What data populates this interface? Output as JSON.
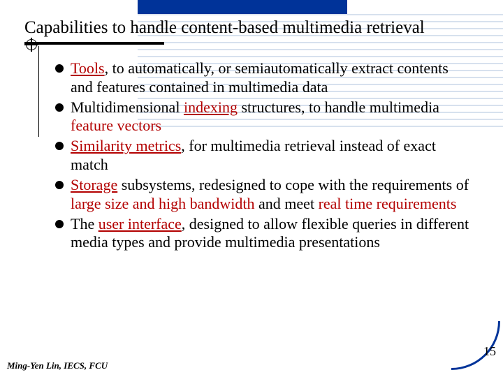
{
  "title": "Capabilities to handle content-based multimedia retrieval",
  "bullets": [
    {
      "segments": [
        {
          "text": "Tools",
          "u": true,
          "r": true
        },
        {
          "text": ", to automatically, or semiautomatically extract contents and features contained in multimedia data"
        }
      ]
    },
    {
      "segments": [
        {
          "text": "Multidimensional "
        },
        {
          "text": "indexing",
          "u": true,
          "r": true
        },
        {
          "text": " structures, to handle multimedia "
        },
        {
          "text": "feature vectors",
          "r": true
        }
      ]
    },
    {
      "segments": [
        {
          "text": "Similarity metrics",
          "u": true,
          "r": true
        },
        {
          "text": ", for multimedia retrieval instead of exact match"
        }
      ]
    },
    {
      "segments": [
        {
          "text": "Storage",
          "u": true,
          "r": true
        },
        {
          "text": " subsystems, redesigned to cope with the requirements of "
        },
        {
          "text": "large size and high bandwidth",
          "r": true
        },
        {
          "text": " and meet "
        },
        {
          "text": "real time requirements",
          "r": true
        }
      ]
    },
    {
      "segments": [
        {
          "text": "The "
        },
        {
          "text": "user interface",
          "u": true,
          "r": true
        },
        {
          "text": ", designed to allow flexible queries in different media types and provide multimedia presentations"
        }
      ]
    }
  ],
  "footer": "Ming-Yen Lin, IECS, FCU",
  "page_number": "15"
}
